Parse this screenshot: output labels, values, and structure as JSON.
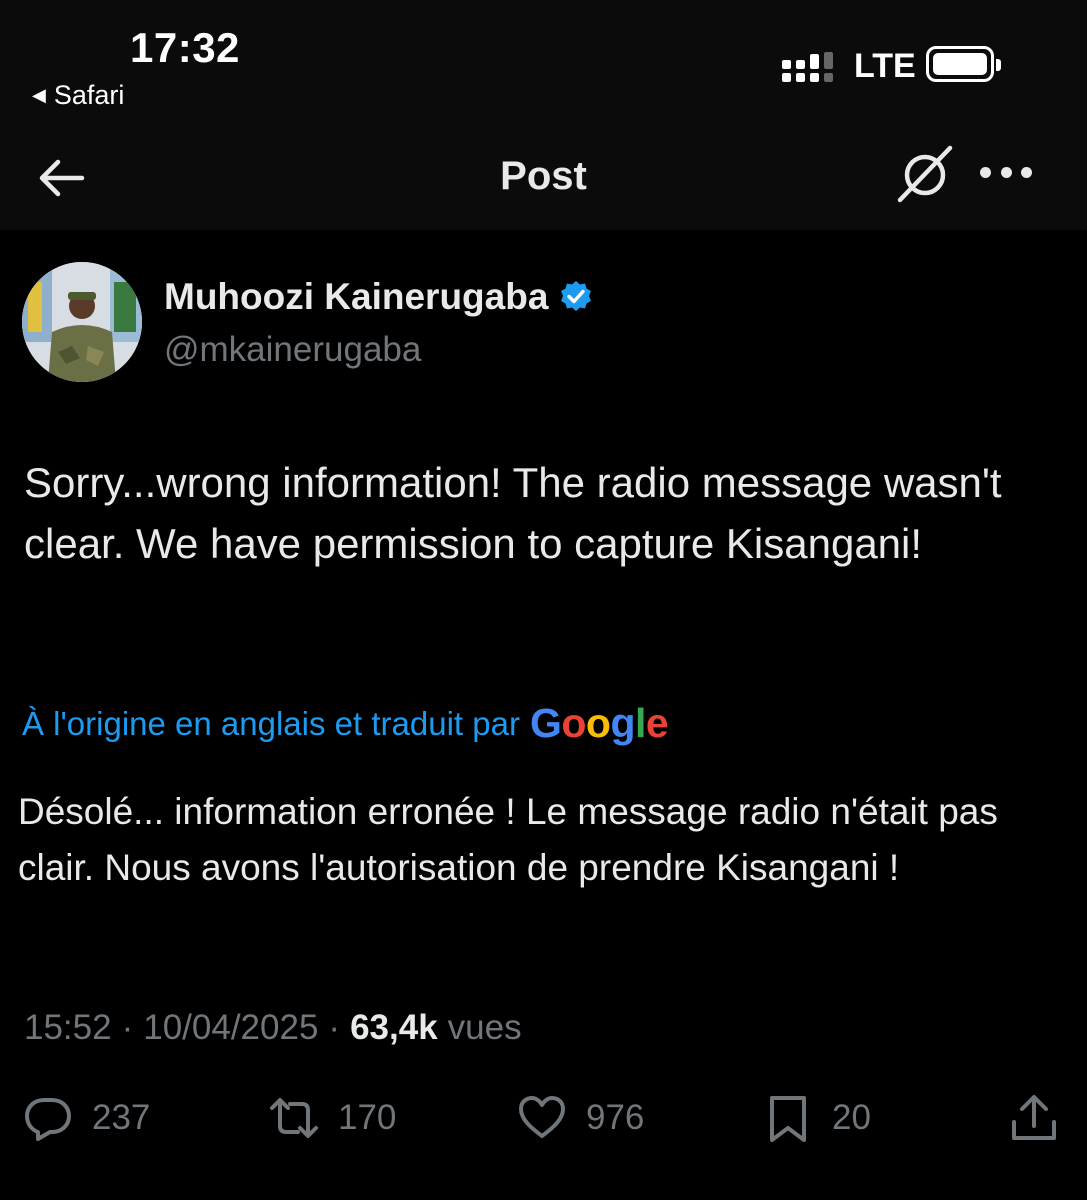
{
  "status_bar": {
    "time": "17:32",
    "back_app": "Safari",
    "network": "LTE"
  },
  "nav": {
    "title": "Post"
  },
  "post": {
    "author_name": "Muhoozi Kainerugaba",
    "handle": "@mkainerugaba",
    "text": "Sorry...wrong information! The radio message wasn't clear. We have permission to capture Kisangani!",
    "translation_note": "À l'origine en anglais et traduit par",
    "translation_provider": "Google",
    "translated_text": "Désolé... information erronée ! Le message radio n'était pas clair. Nous avons l'autorisation de prendre Kisangani !",
    "time": "15:52",
    "separator": "·",
    "date": "10/04/2025",
    "views_count": "63,4k",
    "views_label": "vues"
  },
  "actions": {
    "replies": "237",
    "reposts": "170",
    "likes": "976",
    "bookmarks": "20"
  },
  "colors": {
    "background": "#000000",
    "bar_background": "#0b0b0b",
    "text": "#e7e9ea",
    "muted": "#71767b",
    "link": "#1d9bf0",
    "verified": "#1d9bf0"
  },
  "icons": [
    "back-arrow-icon",
    "grok-icon",
    "more-icon",
    "verified-badge-icon",
    "reply-icon",
    "repost-icon",
    "like-icon",
    "bookmark-icon",
    "share-icon"
  ]
}
